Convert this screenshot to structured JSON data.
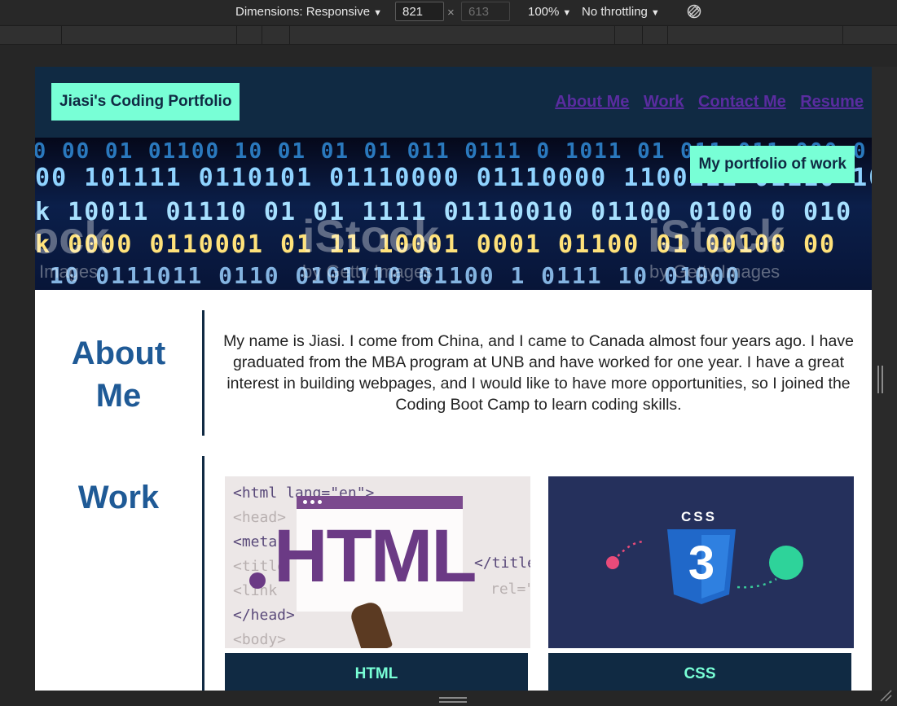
{
  "devtools": {
    "dimensions_label": "Dimensions: Responsive",
    "width_value": "821",
    "height_placeholder": "613",
    "times_symbol": "×",
    "zoom": "100%",
    "throttling": "No throttling",
    "caret": "▼"
  },
  "header": {
    "brand": "Jiasi's Coding Portfolio",
    "nav": [
      "About Me",
      "Work",
      "Contact Me",
      "Resume"
    ]
  },
  "hero": {
    "tag": "My portfolio of work",
    "watermark": "iStock",
    "watermark_sub": "by Getty Images",
    "watermark_sub2": "Images",
    "watermark_left": "ock"
  },
  "about": {
    "title_line1": "About",
    "title_line2": "Me",
    "text": "My name is Jiasi. I come from China, and I came to Canada almost four years ago. I have graduated from the MBA program at UNB and have worked for one year. I have a great interest in building webpages, and I would like to have more opportunities, so I joined the Coding Boot Camp to learn coding skills."
  },
  "work": {
    "title": "Work",
    "cards": [
      {
        "label": "HTML",
        "image_text": "HTML",
        "code_lines": [
          "<html lang=\"en\">",
          "<head>",
          "<meta",
          "<title",
          "<link",
          "</head>",
          "<body>"
        ],
        "code_right": "</title",
        "code_right2": "rel=\""
      },
      {
        "label": "CSS",
        "image_text": "CSS",
        "badge_number": "3"
      }
    ]
  },
  "colors": {
    "navy": "#102a43",
    "mint": "#78ffd6",
    "title_blue": "#1f5a96",
    "link_purple": "#5a2ca0"
  }
}
